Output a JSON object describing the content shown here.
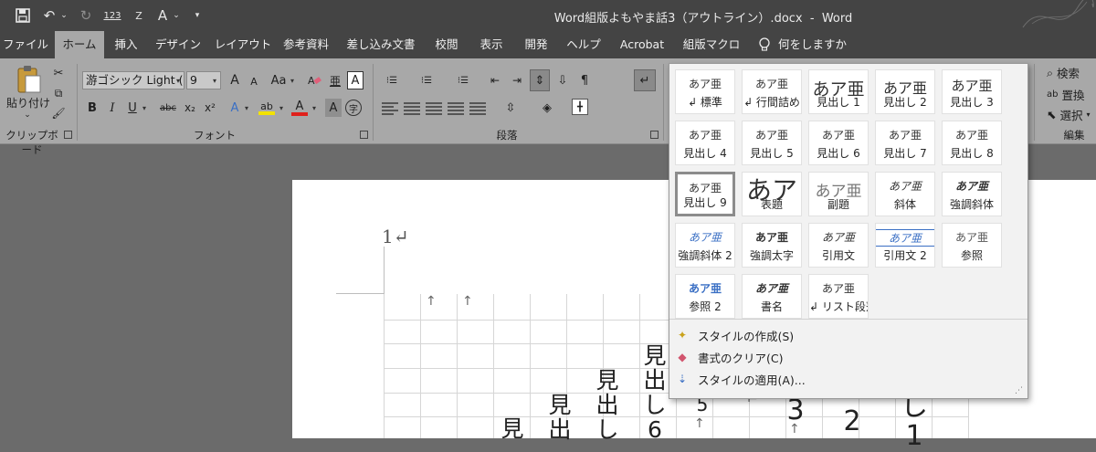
{
  "titlebar": {
    "doc_title": "Word組版よもやま話3（アウトライン）.docx  -  Word",
    "qat": {
      "save_icon": "save-icon",
      "undo_icon": "undo-icon",
      "redo_icon": "redo-icon",
      "number_label": "123",
      "az_label": "Z",
      "font_icon": "font-color-icon"
    }
  },
  "tabs": [
    "ファイル",
    "ホーム",
    "挿入",
    "デザイン",
    "レイアウト",
    "参考資料",
    "差し込み文書",
    "校閲",
    "表示",
    "開発",
    "ヘルプ",
    "Acrobat",
    "組版マクロ"
  ],
  "active_tab": "ホーム",
  "tellme": {
    "label": "何をしますか",
    "icon": "lightbulb-icon"
  },
  "ribbon": {
    "clipboard": {
      "paste_label": "貼り付け",
      "group_label": "クリップボード"
    },
    "font": {
      "font_name": "游ゴシック Light (",
      "font_size": "9",
      "grow": "A",
      "shrink": "A",
      "case": "Aa",
      "clear_icon": "clear-format-icon",
      "phonetic": "亜",
      "boxed": "A",
      "bold": "B",
      "italic": "I",
      "underline": "U",
      "strike": "abc",
      "sub": "x₂",
      "sup": "x²",
      "effects": "A",
      "highlight": "ab",
      "fontcolor": "A",
      "shade": "A",
      "enclose": "字",
      "group_label": "フォント"
    },
    "paragraph": {
      "group_label": "段落"
    },
    "editing": {
      "find": "検索",
      "replace": "置換",
      "select": "選択",
      "group_label": "編集"
    }
  },
  "colors": {
    "highlight": "#f2e200",
    "fontcolor": "#e0201b",
    "ribbon": "#a8a8a8",
    "titlebar": "#444444"
  },
  "document": {
    "page_number": "1↵",
    "columns": [
      {
        "text": [
          "見"
        ]
      },
      {
        "text": [
          "見",
          "出"
        ]
      },
      {
        "text": [
          "見",
          "出",
          "し"
        ]
      },
      {
        "text": [
          "見",
          "出",
          "し",
          "6"
        ]
      },
      {
        "text": [
          "5"
        ]
      },
      {
        "text": [
          "3"
        ]
      },
      {
        "text": [
          "2"
        ]
      },
      {
        "text": [
          "し",
          "1"
        ]
      }
    ]
  },
  "gallery": {
    "styles": [
      {
        "preview": "あア亜",
        "label": "↲ 標準"
      },
      {
        "preview": "あア亜",
        "label": "↲ 行間詰め"
      },
      {
        "preview": "あア亜",
        "label": "見出し 1"
      },
      {
        "preview": "あア亜",
        "label": "見出し 2"
      },
      {
        "preview": "あア亜",
        "label": "見出し 3"
      },
      {
        "preview": "あア亜",
        "label": "見出し 4"
      },
      {
        "preview": "あア亜",
        "label": "見出し 5"
      },
      {
        "preview": "あア亜",
        "label": "見出し 6"
      },
      {
        "preview": "あア亜",
        "label": "見出し 7"
      },
      {
        "preview": "あア亜",
        "label": "見出し 8"
      },
      {
        "preview": "あア亜",
        "label": "見出し 9"
      },
      {
        "preview": "あア",
        "label": "表題"
      },
      {
        "preview": "あア亜",
        "label": "副題"
      },
      {
        "preview": "あア亜",
        "label": "斜体"
      },
      {
        "preview": "あア亜",
        "label": "強調斜体"
      },
      {
        "preview": "あア亜",
        "label": "強調斜体 2"
      },
      {
        "preview": "あア亜",
        "label": "強調太字"
      },
      {
        "preview": "あア亜",
        "label": "引用文"
      },
      {
        "preview": "あア亜",
        "label": "引用文 2"
      },
      {
        "preview": "あア亜",
        "label": "参照"
      },
      {
        "preview": "あア亜",
        "label": "参照 2"
      },
      {
        "preview": "あア亜",
        "label": "書名"
      },
      {
        "preview": "あア亜",
        "label": "↲ リスト段落"
      }
    ],
    "selected": "見出し 9",
    "commands": [
      {
        "icon": "create-style-icon",
        "label": "スタイルの作成(S)"
      },
      {
        "icon": "clear-formatting-icon",
        "label": "書式のクリア(C)"
      },
      {
        "icon": "apply-styles-icon",
        "label": "スタイルの適用(A)..."
      }
    ]
  }
}
